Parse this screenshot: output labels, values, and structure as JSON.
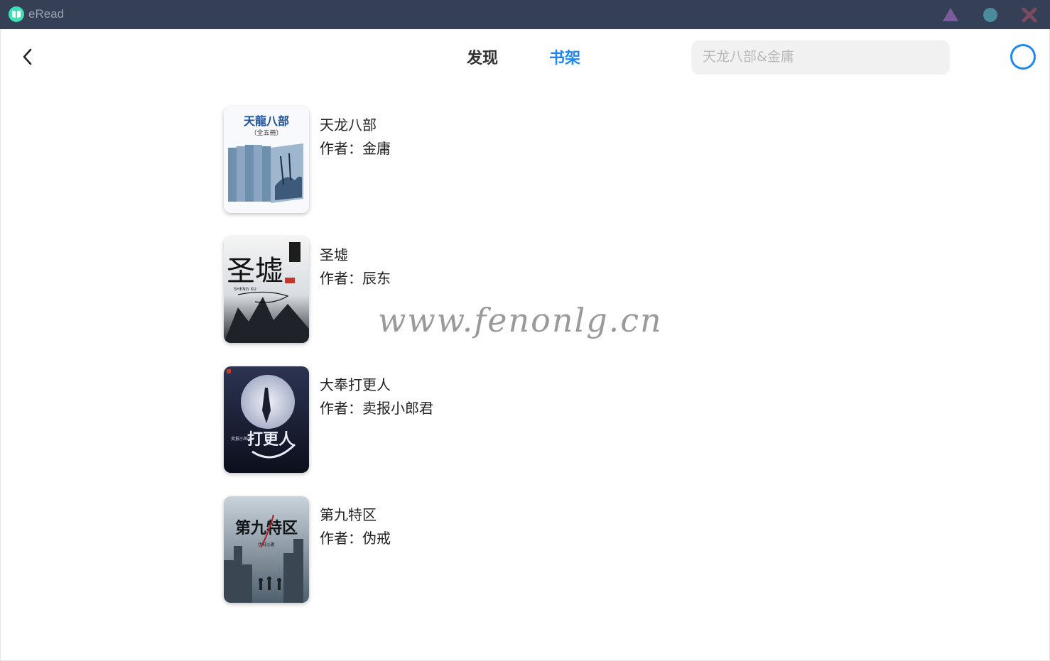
{
  "window": {
    "app_name": "eRead",
    "colors": {
      "titlebar": "#353f55",
      "logo": "#3fe0b5",
      "minimize": "#7c5a9e",
      "maximize": "#4a8c9c",
      "close": "#7c4a5e"
    }
  },
  "header": {
    "tabs": [
      {
        "label": "发现",
        "active": false
      },
      {
        "label": "书架",
        "active": true
      }
    ],
    "search": {
      "placeholder": "天龙八部&金庸",
      "value": ""
    },
    "accent": "#1e88f1"
  },
  "books": [
    {
      "title": "天龙八部",
      "author": "作者：金庸",
      "cover": {
        "text": "天龍八部",
        "subtext": "（全五冊）",
        "icon": "book-set-cover"
      }
    },
    {
      "title": "圣墟",
      "author": "作者：辰东",
      "cover": {
        "text": "圣墟",
        "subtext": "SHENG XU",
        "icon": "ink-mountain-cover"
      }
    },
    {
      "title": "大奉打更人",
      "author": "作者：卖报小郎君",
      "cover": {
        "text": "打更人",
        "subtext": "卖报小郎君",
        "icon": "moon-swordsman-cover"
      }
    },
    {
      "title": "第九特区",
      "author": "作者：伪戒",
      "cover": {
        "text": "第九特区",
        "subtext": "伪戒◎著",
        "icon": "ruined-city-cover"
      }
    }
  ],
  "watermark": "www.fenonlg.cn"
}
